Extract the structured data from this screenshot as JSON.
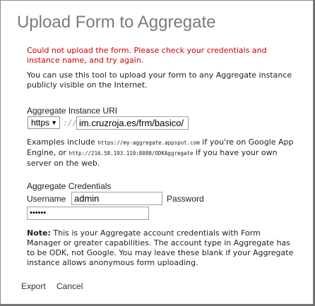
{
  "dialog": {
    "title": "Upload Form to Aggregate",
    "error": "Could not upload the form. Please check your credentials and instance name, and try again.",
    "intro": "You can use this tool to upload your form to any Aggregate instance publicly visible on the Internet."
  },
  "instance": {
    "section_label": "Aggregate Instance URI",
    "protocol_selected": "https",
    "separator": "://",
    "url_value": "im.cruzroja.es/frm/basico/"
  },
  "examples": {
    "prefix": "Examples include ",
    "example1": "https://my-aggregate.appspot.com",
    "middle": " if you're on Google App Engine, or ",
    "example2": "http://216.58.193.110:8080/ODKAggregate",
    "suffix": " if you have your own server on the web."
  },
  "credentials": {
    "section_label": "Aggregate Credentials",
    "username_label": "Username",
    "username_value": "admin",
    "password_label": "Password",
    "password_value": "••••••"
  },
  "note": {
    "bold": "Note:",
    "text": " This is your Aggregate account credentials with Form Manager or greater capabilities. The account type in Aggregate has to be ODK, not Google. You may leave these blank if your Aggregate instance allows anonymous form uploading."
  },
  "buttons": {
    "export": "Export",
    "cancel": "Cancel"
  }
}
